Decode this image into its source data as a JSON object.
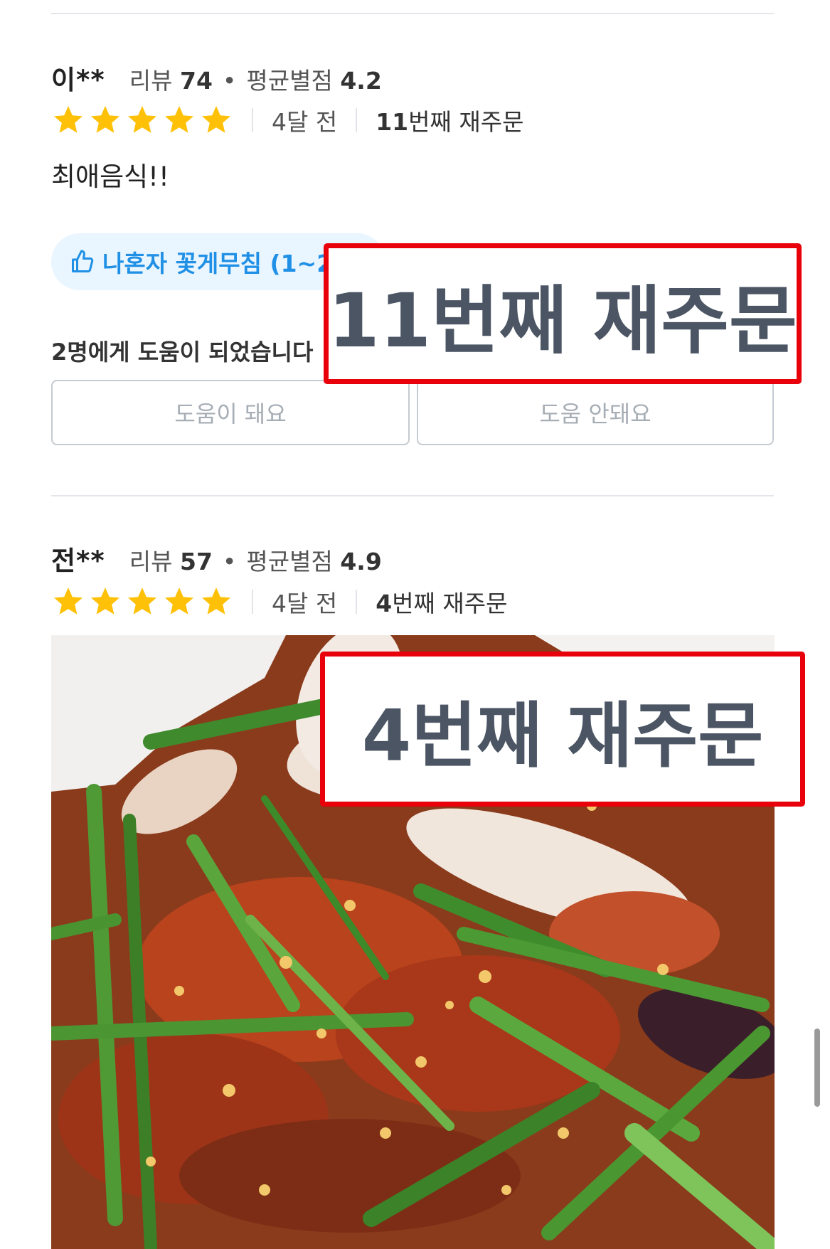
{
  "reviews": [
    {
      "nickname": "이**",
      "review_label": "리뷰",
      "review_count": "74",
      "dot": "•",
      "avg_label": "평균별점",
      "avg_rating": "4.2",
      "stars": 5,
      "date": "4달 전",
      "reorder_num": "11",
      "reorder_suffix": "번째 재주문",
      "text": "최애음식!!",
      "menu_chip": "나혼자 꽃게무침 (1~2",
      "helped_text": "2명에게 도움이 되었습니다",
      "helpful_label": "도움이 돼요",
      "not_helpful_label": "도움 안돼요"
    },
    {
      "nickname": "전**",
      "review_label": "리뷰",
      "review_count": "57",
      "dot": "•",
      "avg_label": "평균별점",
      "avg_rating": "4.9",
      "stars": 5,
      "date": "4달 전",
      "reorder_num": "4",
      "reorder_suffix": "번째 재주문"
    }
  ],
  "callouts": [
    {
      "text": "11번째 재주문"
    },
    {
      "text": "4번째 재주문"
    }
  ],
  "photo": {
    "subject": "food-photo-spicy-seasoned-squid-with-chives"
  },
  "colors": {
    "star": "#FFC107",
    "callout_border": "#E8000B",
    "chip_text": "#1F90E6",
    "chip_bg": "#E9F5FF"
  }
}
